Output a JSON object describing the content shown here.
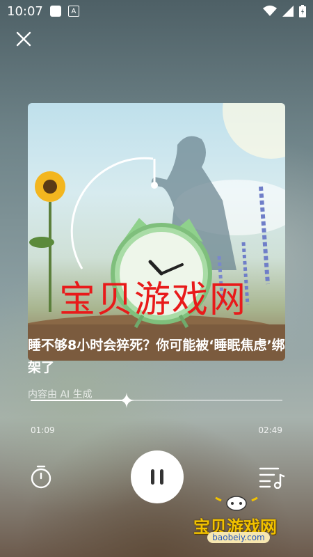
{
  "status_bar": {
    "time": "10:07",
    "keyboard_indicator": "A"
  },
  "player": {
    "close_icon": "close-icon",
    "title": "睡不够8小时会猝死？你可能被‘睡眠焦虑’绑架了",
    "ai_note": "内容由 AI 生成",
    "current_time": "01:09",
    "total_time": "02:49",
    "progress": 0.38,
    "state": "playing"
  },
  "watermarks": {
    "overlay_text": "宝贝游戏网",
    "logo_text": "宝贝游戏网",
    "logo_domain": "baobeiy.com"
  },
  "colors": {
    "watermark_red": "#e81a1a",
    "logo_yellow": "#f2c200"
  }
}
